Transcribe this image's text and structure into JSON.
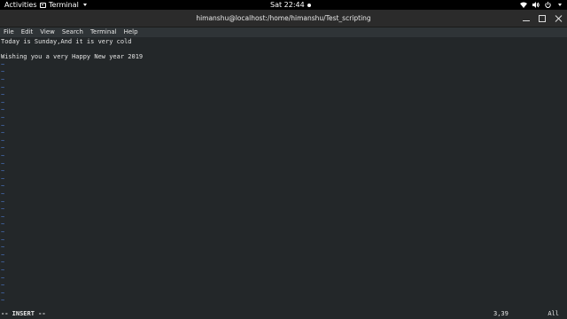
{
  "topbar": {
    "activities": "Activities",
    "app_name": "Terminal",
    "clock": "Sat 22:44"
  },
  "window": {
    "title": "himanshu@localhost:/home/himanshu/Test_scripting"
  },
  "menu": [
    "File",
    "Edit",
    "View",
    "Search",
    "Terminal",
    "Help"
  ],
  "editor": {
    "lines": [
      "Today is Sunday,And it is very cold",
      "",
      "Wishing you a very Happy New year 2019"
    ],
    "tilde": "~",
    "mode": "-- INSERT --",
    "cursor_pos": "3,39",
    "scroll": "All",
    "tilde_color": "#4c76c7",
    "bg_color": "#232729"
  }
}
